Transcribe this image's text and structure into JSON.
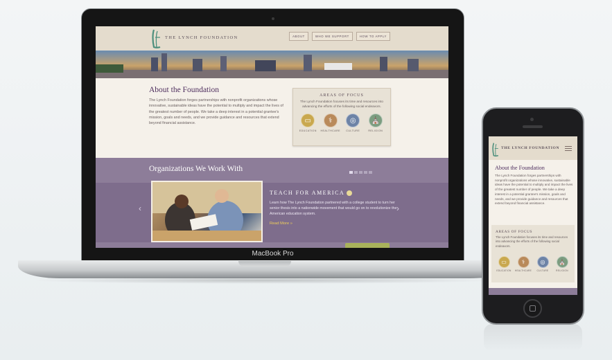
{
  "laptop": {
    "label": "MacBook Pro"
  },
  "site": {
    "name": "THE LYNCH FOUNDATION",
    "nav": [
      "ABOUT",
      "WHO WE SUPPORT",
      "HOW TO APPLY"
    ],
    "about": {
      "title": "About the Foundation",
      "body": "The Lynch Foundation forges partnerships with nonprofit organizations whose innovative, sustainable ideas have the potential to multiply and impact the lives of the greatest number of people. We take a deep interest in a potential grantee's mission, goals and needs, and we provide guidance and resources that extend beyond financial assistance."
    },
    "focus": {
      "title": "AREAS OF FOCUS",
      "desc": "The Lynch Foundation focuses its time and resources into advancing the efforts of the following social endeavors.",
      "items": [
        {
          "label": "EDUCATION",
          "icon": "book-icon",
          "glyph": "▭",
          "color": "#c9a84e"
        },
        {
          "label": "HEALTHCARE",
          "icon": "caduceus-icon",
          "glyph": "⚕",
          "color": "#b98a5a"
        },
        {
          "label": "CULTURE",
          "icon": "globe-icon",
          "glyph": "◎",
          "color": "#6d83a6"
        },
        {
          "label": "RELIGION",
          "icon": "church-icon",
          "glyph": "⛪",
          "color": "#7c9d80"
        }
      ]
    },
    "orgs": {
      "title": "Organizations We Work With",
      "org_name": "TEACH FOR AMERICA",
      "org_desc": "Learn how The Lynch Foundation partnered with a college student to turn her senior thesis into a nationwide movement that would go on to revolutionize the American education system.",
      "read_more": "Read More »",
      "prev": "‹",
      "next": "›",
      "slide_count": 5,
      "active_slide": 1
    }
  },
  "mobile": {
    "name": "THE LYNCH FOUNDATION",
    "about_title": "About the Foundation",
    "about_body": "The Lynch Foundation forges partnerships with nonprofit organizations whose innovative, sustainable ideas have the potential to multiply and impact the lives of the greatest number of people. We take a deep interest in a potential grantee's mission, goals and needs, and we provide guidance and resources that extend beyond financial assistance.",
    "focus_title": "AREAS OF FOCUS",
    "focus_desc": "The Lynch Foundation focuses its time and resources into advancing the efforts of the following social endeavors."
  }
}
